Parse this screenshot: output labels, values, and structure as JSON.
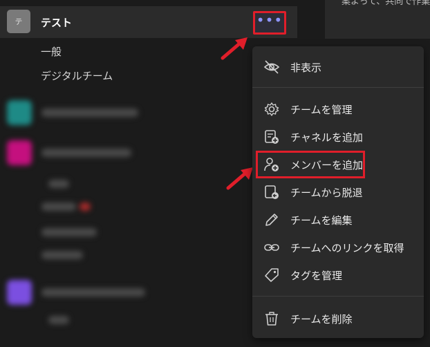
{
  "right_panel": {
    "snippet": "案よって、共同で作業"
  },
  "team": {
    "avatar_letter": "テ",
    "name": "テスト",
    "more_label": "•••"
  },
  "channels": [
    {
      "label": "一般"
    },
    {
      "label": "デジタルチーム"
    }
  ],
  "menu": {
    "items": [
      {
        "label": "非表示",
        "icon": "eye-off-icon"
      },
      {
        "label": "チームを管理",
        "icon": "gear-icon"
      },
      {
        "label": "チャネルを追加",
        "icon": "add-channel-icon"
      },
      {
        "label": "メンバーを追加",
        "icon": "add-person-icon"
      },
      {
        "label": "チームから脱退",
        "icon": "leave-team-icon"
      },
      {
        "label": "チームを編集",
        "icon": "pencil-icon"
      },
      {
        "label": "チームへのリンクを取得",
        "icon": "link-icon"
      },
      {
        "label": "タグを管理",
        "icon": "tag-icon"
      },
      {
        "label": "チームを削除",
        "icon": "trash-icon"
      }
    ]
  },
  "colors": {
    "highlight_red": "#e01e2a",
    "arrow_red": "#e01e2a",
    "accent": "#8f95ff"
  }
}
